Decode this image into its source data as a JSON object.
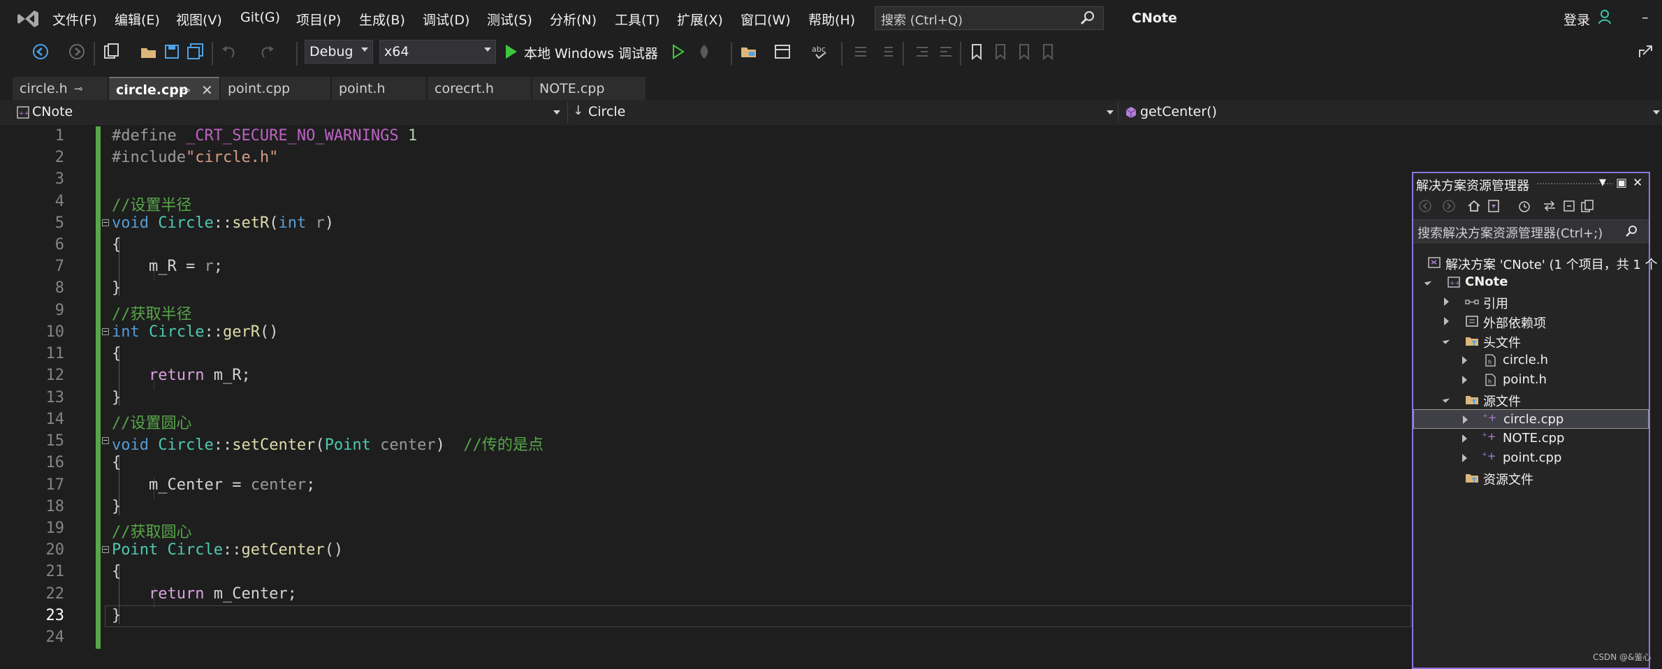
{
  "menubar": {
    "items": [
      "文件(F)",
      "编辑(E)",
      "视图(V)",
      "Git(G)",
      "项目(P)",
      "生成(B)",
      "调试(D)",
      "测试(S)",
      "分析(N)",
      "工具(T)",
      "扩展(X)",
      "窗口(W)",
      "帮助(H)"
    ],
    "search_placeholder": "搜索 (Ctrl+Q)",
    "solution_title": "CNote",
    "login": "登录",
    "minimize": "–"
  },
  "toolbar": {
    "configuration": "Debug",
    "platform": "x64",
    "debugger_label": "本地 Windows 调试器"
  },
  "tabs": [
    {
      "label": "circle.h",
      "pinned": true,
      "active": false
    },
    {
      "label": "circle.cpp",
      "pinned": true,
      "active": true
    },
    {
      "label": "point.cpp",
      "active": false
    },
    {
      "label": "point.h",
      "active": false
    },
    {
      "label": "corecrt.h",
      "active": false
    },
    {
      "label": "NOTE.cpp",
      "active": false
    }
  ],
  "navbar": {
    "project": "CNote",
    "scope": "Circle",
    "member": "getCenter()"
  },
  "editor": {
    "current_line": 23,
    "line_numbers": [
      "1",
      "2",
      "3",
      "4",
      "5",
      "6",
      "7",
      "8",
      "9",
      "10",
      "11",
      "12",
      "13",
      "14",
      "15",
      "16",
      "17",
      "18",
      "19",
      "20",
      "21",
      "22",
      "23",
      "24"
    ],
    "tokens": {
      "define": "#define ",
      "macro": "_CRT_SECURE_NO_WARNINGS",
      "one": " 1",
      "include": "#include",
      "include_str": "\"circle.h\"",
      "c_setR": "//设置半径",
      "c_getR": "//获取半径",
      "c_setCenter": "//设置圆心",
      "c_passPoint": "//传的是点",
      "c_getCenter": "//获取圆心",
      "void": "void",
      "int": "int",
      "Circle": "Circle",
      "Point": "Point",
      "sep": "::",
      "setR": "setR",
      "gerR": "gerR",
      "setCenter": "setCenter",
      "getCenter": "getCenter",
      "lparen": "(",
      "rparen": ")",
      "emptyparens": "()",
      "param_r": "r",
      "param_center": "center",
      "open": "{",
      "close": "}",
      "assignR_lhs": "m_R = ",
      "semi": ";",
      "return": "return",
      "m_R": " m_R;",
      "assignC_lhs": "m_Center = ",
      "m_Center": " m_Center;"
    }
  },
  "solution_explorer": {
    "title": "解决方案资源管理器",
    "search_placeholder": "搜索解决方案资源管理器(Ctrl+;)",
    "solution": "解决方案 'CNote' (1 个项目，共 1 个",
    "project": "CNote",
    "items": [
      {
        "label": "引用"
      },
      {
        "label": "外部依赖项"
      },
      {
        "label": "头文件"
      },
      {
        "label": "circle.h"
      },
      {
        "label": "point.h"
      },
      {
        "label": "源文件"
      },
      {
        "label": "circle.cpp",
        "selected": true
      },
      {
        "label": "NOTE.cpp"
      },
      {
        "label": "point.cpp"
      },
      {
        "label": "资源文件"
      }
    ]
  },
  "watermark": "CSDN @&鉴心",
  "colors": {
    "background": "#1e1e1e",
    "comment": "#57a64a",
    "keyword": "#569cd6",
    "class": "#4ec9b0",
    "function": "#dcdcaa",
    "explorer_border": "#8f76e0"
  }
}
